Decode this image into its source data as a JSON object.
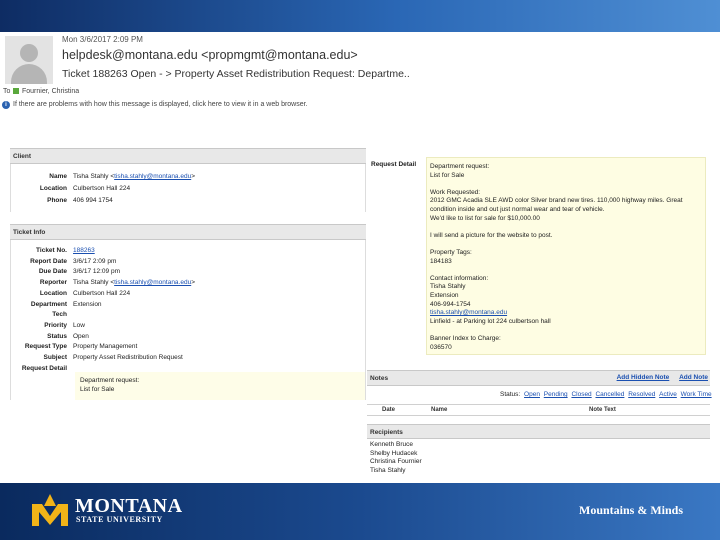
{
  "email": {
    "date": "Mon 3/6/2017 2:09 PM",
    "from": "helpdesk@montana.edu <propmgmt@montana.edu>",
    "subject": "Ticket 188263 Open - > Property Asset Redistribution Request: Departme..",
    "to_label": "To",
    "to_name": "Fournier, Christina",
    "info_text": "If there are problems with how this message is displayed, click here to view it in a web browser."
  },
  "client": {
    "heading": "Client",
    "rows": [
      {
        "label": "Name",
        "value": "Tisha Stahly <",
        "link": "tisha.stahly@montana.edu",
        "suffix": ">"
      },
      {
        "label": "Location",
        "value": "Culbertson Hall 224"
      },
      {
        "label": "Phone",
        "value": "406 994 1754"
      }
    ]
  },
  "ticket_info": {
    "heading": "Ticket Info",
    "rows": [
      {
        "label": "Ticket No.",
        "link": "188263"
      },
      {
        "label": "Report Date",
        "value": "3/6/17 2:09 pm"
      },
      {
        "label": "Due Date",
        "value": "3/6/17 12:09 pm"
      },
      {
        "label": "Reporter",
        "value": "Tisha Stahly <",
        "link": "tisha.stahly@montana.edu",
        "suffix": ">"
      },
      {
        "label": "Location",
        "value": "Culbertson Hall 224"
      },
      {
        "label": "Department",
        "value": "Extension"
      },
      {
        "label": "Tech",
        "value": ""
      },
      {
        "label": "Priority",
        "value": "Low"
      },
      {
        "label": "Status",
        "value": "Open"
      },
      {
        "label": "Request Type",
        "value": "Property Management"
      },
      {
        "label": "Subject",
        "value": "Property Asset Redistribution Request"
      },
      {
        "label": "Request Detail",
        "value": ""
      }
    ],
    "request_detail_lines": [
      "Department request:",
      "List for Sale"
    ]
  },
  "request_detail": {
    "label": "Request Detail",
    "lines": [
      "Department request:",
      "List for Sale",
      "",
      "Work Requested:",
      "2012 GMC Acadia SLE AWD color Silver brand new tires.  110,000 highway miles.  Great",
      "condition inside and out just normal wear and tear of vehicle.",
      "We'd like to list for sale for $10,000.00",
      "",
      "  I will send a picture for the website to post.",
      "",
      "Property Tags:",
      "184183",
      "",
      "Contact information:",
      "Tisha Stahly",
      "Extension",
      "406-994-1754",
      "tisha.stahly@montana.edu",
      "Linfield - at Parking lot 224 culbertson hall",
      "",
      "Banner Index to Charge:",
      "036570"
    ]
  },
  "notes": {
    "heading": "Notes",
    "add_hidden_note": "Add Hidden Note",
    "add_note": "Add Note",
    "status_prefix": "Status:",
    "status_links": [
      "Open",
      "Pending",
      "Closed",
      "Cancelled",
      "Resolved",
      "Active",
      "Work Time"
    ],
    "col_date": "Date",
    "col_name": "Name",
    "col_note": "Note Text"
  },
  "recipients": {
    "heading": "Recipients",
    "names": [
      "Kenneth Bruce",
      "Shelby Hudacek",
      "Christina Fournier",
      "Tisha Stahly"
    ]
  },
  "footer": {
    "logo_title": "MONTANA",
    "logo_subtitle": "STATE UNIVERSITY",
    "tagline": "Mountains & Minds"
  },
  "colors": {
    "brand_navy": "#0e2c63",
    "brand_gold": "#f2b418",
    "link": "#1a4fb0",
    "yellow_box": "#fefde3"
  }
}
